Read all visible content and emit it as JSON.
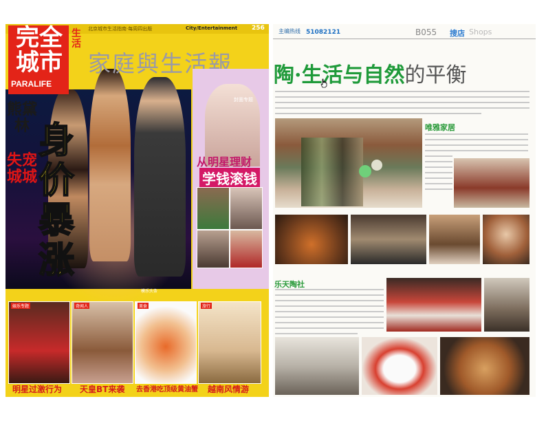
{
  "left_page": {
    "header_strip": {
      "left_text": "北京城市生活指南·每周四出版",
      "right_text": "City/Entertainment",
      "page_no": "256"
    },
    "logo": {
      "main": "完全城市",
      "side": "生活",
      "sub": "PARALIFE"
    },
    "masthead": "家庭與生活報",
    "cover_name": "熊黛林",
    "cover_sub": "失宠城城",
    "headline": "身价暴涨",
    "cover_caption": "模乐头条",
    "side_feature": {
      "tag": "封面专题",
      "line1": "从明星理财",
      "line2": "学钱滚钱"
    },
    "bottom_items": [
      {
        "tag": "娱乐专题",
        "caption": "明星过激行为"
      },
      {
        "tag": "奇闻人",
        "caption": "天皇BT来袭"
      },
      {
        "tag": "美食",
        "caption": "去香港吃顶级黄油蟹"
      },
      {
        "tag": "旅行",
        "caption": "越南风情游"
      }
    ]
  },
  "right_page": {
    "top_code_label": "主编热线",
    "top_code": "51082121",
    "page_code": "B055",
    "section": "搜店",
    "section_en": "Shops",
    "title_main": "陶·生活与自然",
    "title_tail": "的平衡",
    "subheads": [
      "唯雅家居",
      "乐天陶社"
    ]
  }
}
